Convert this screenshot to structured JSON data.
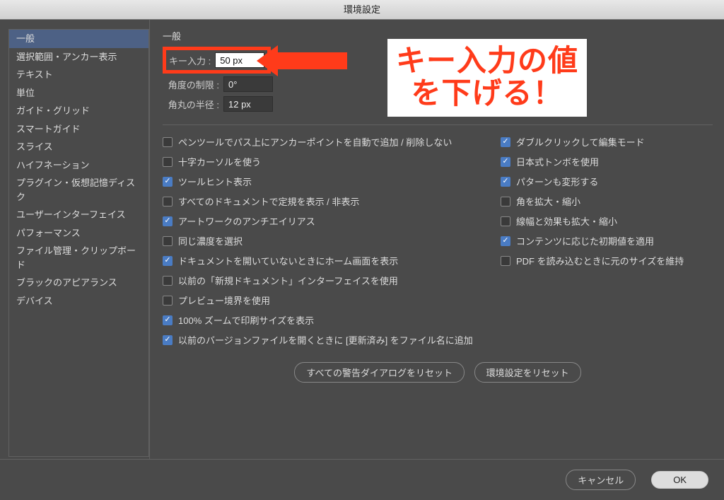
{
  "window": {
    "title": "環境設定"
  },
  "sidebar": {
    "items": [
      {
        "label": "一般",
        "selected": true
      },
      {
        "label": "選択範囲・アンカー表示",
        "selected": false
      },
      {
        "label": "テキスト",
        "selected": false
      },
      {
        "label": "単位",
        "selected": false
      },
      {
        "label": "ガイド・グリッド",
        "selected": false
      },
      {
        "label": "スマートガイド",
        "selected": false
      },
      {
        "label": "スライス",
        "selected": false
      },
      {
        "label": "ハイフネーション",
        "selected": false
      },
      {
        "label": "プラグイン・仮想記憶ディスク",
        "selected": false
      },
      {
        "label": "ユーザーインターフェイス",
        "selected": false
      },
      {
        "label": "パフォーマンス",
        "selected": false
      },
      {
        "label": "ファイル管理・クリップボード",
        "selected": false
      },
      {
        "label": "ブラックのアピアランス",
        "selected": false
      },
      {
        "label": "デバイス",
        "selected": false
      }
    ]
  },
  "panel": {
    "title": "一般",
    "key_input": {
      "label": "キー入力 :",
      "value": "50 px"
    },
    "angle": {
      "label": "角度の制限 :",
      "value": "0°"
    },
    "corner": {
      "label": "角丸の半径 :",
      "value": "12 px"
    },
    "checks_left": [
      {
        "label": "ペンツールでパス上にアンカーポイントを自動で追加 / 削除しない",
        "checked": false
      },
      {
        "label": "十字カーソルを使う",
        "checked": false
      },
      {
        "label": "ツールヒント表示",
        "checked": true
      },
      {
        "label": "すべてのドキュメントで定規を表示 / 非表示",
        "checked": false
      },
      {
        "label": "アートワークのアンチエイリアス",
        "checked": true
      },
      {
        "label": "同じ濃度を選択",
        "checked": false
      },
      {
        "label": "ドキュメントを開いていないときにホーム画面を表示",
        "checked": true
      },
      {
        "label": "以前の「新規ドキュメント」インターフェイスを使用",
        "checked": false
      },
      {
        "label": "プレビュー境界を使用",
        "checked": false
      },
      {
        "label": "100% ズームで印刷サイズを表示",
        "checked": true
      },
      {
        "label": "以前のバージョンファイルを開くときに [更新済み] をファイル名に追加",
        "checked": true
      }
    ],
    "checks_right": [
      {
        "label": "ダブルクリックして編集モード",
        "checked": true
      },
      {
        "label": "日本式トンボを使用",
        "checked": true
      },
      {
        "label": "パターンも変形する",
        "checked": true
      },
      {
        "label": "角を拡大・縮小",
        "checked": false
      },
      {
        "label": "線幅と効果も拡大・縮小",
        "checked": false
      },
      {
        "label": "コンテンツに応じた初期値を適用",
        "checked": true
      },
      {
        "label": "PDF を読み込むときに元のサイズを維持",
        "checked": false
      }
    ],
    "reset_all": "すべての警告ダイアログをリセット",
    "reset_prefs": "環境設定をリセット"
  },
  "footer": {
    "cancel": "キャンセル",
    "ok": "OK"
  },
  "annotation": {
    "line1": "キー入力の値",
    "line2": "を下げる！"
  }
}
